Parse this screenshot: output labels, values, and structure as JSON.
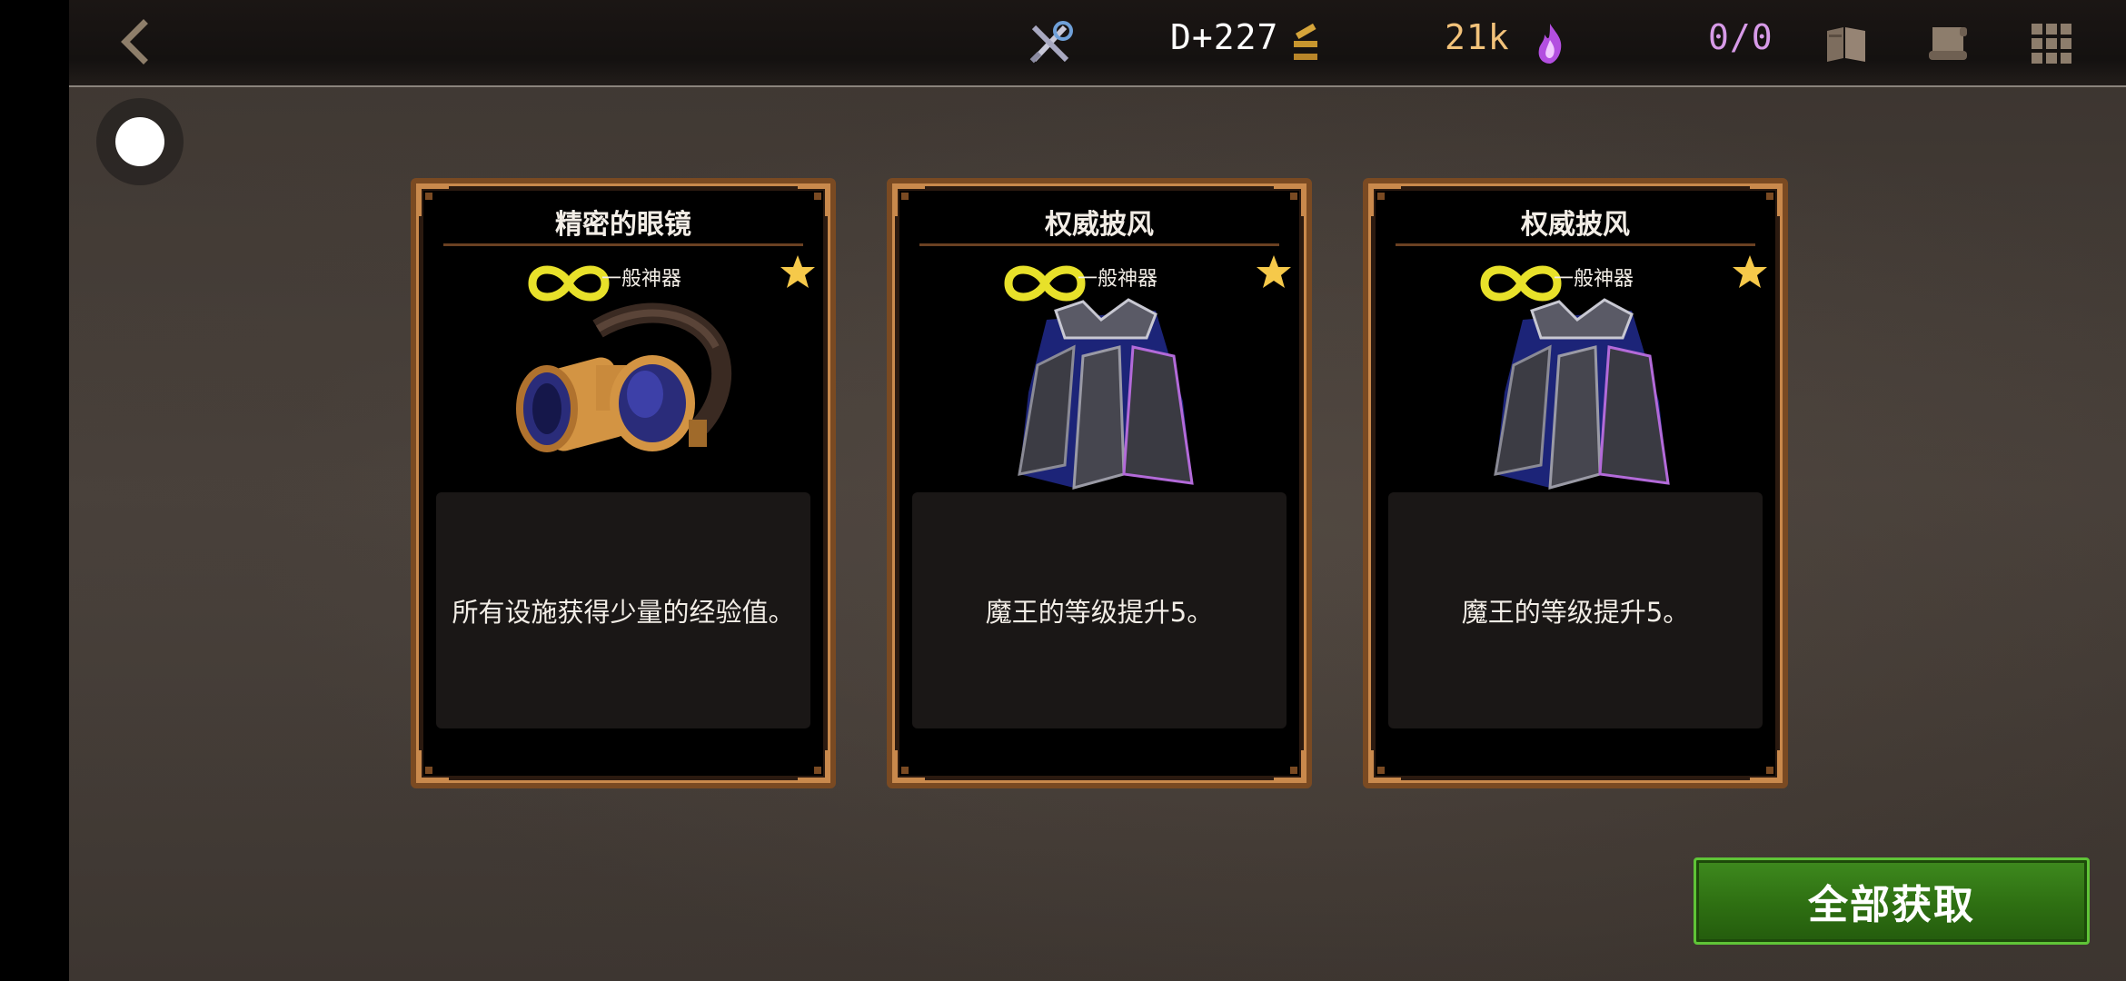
{
  "hud": {
    "day": "D+227",
    "currency": "21k",
    "counter": "0/0"
  },
  "cards": [
    {
      "title": "精密的眼镜",
      "tier": "一般神器",
      "description": "所有设施获得少量的经验值。",
      "art_icon": "goggles-icon"
    },
    {
      "title": "权威披风",
      "tier": "一般神器",
      "description": "魔王的等级提升5。",
      "art_icon": "cape-icon"
    },
    {
      "title": "权威披风",
      "tier": "一般神器",
      "description": "魔王的等级提升5。",
      "art_icon": "cape-icon"
    }
  ],
  "collect_all_label": "全部获取",
  "colors": {
    "day_text": "#ffffff",
    "currency_text": "#f2c27a",
    "counter_text": "#d79ae8",
    "infinity": "#e8e12a",
    "star": "#f6c94a",
    "button_green": "#2e6f12"
  }
}
